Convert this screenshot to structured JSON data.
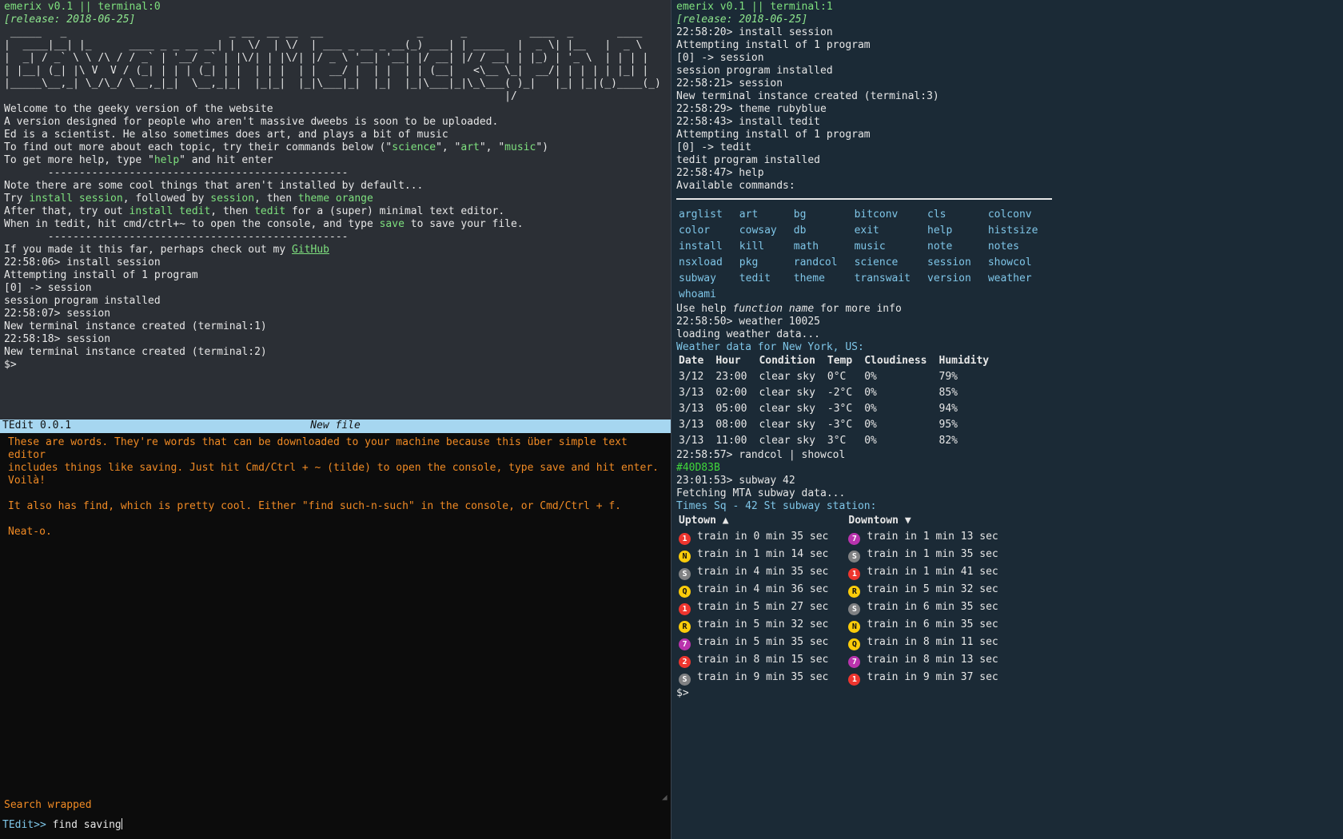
{
  "colors": {
    "t0_bg": "#2b2f35",
    "t1_bg": "#1b2a36",
    "green": "#7ee07e",
    "cyan": "#7fc6e8",
    "orange": "#f08a24",
    "tedit_bar": "#a6d6f0"
  },
  "t0": {
    "header": "emerix v0.1 || terminal:0",
    "release": "[release: 2018-06-25]",
    "ascii": [
      " _____   _                          _ __  __ __  __               _      _          ____  _       ____ ",
      "|  ____|__| |_      ____ _ _ __ __| |  \\/  | \\/  | ___ _ __ _ __(_) ___| | _____  |  _ \\| |__   |  _ \\",
      "|  _| / _` \\ \\ /\\ / / _` | '__/ _` | |\\/| | |\\/| |/ _ \\ '__| '__| |/ __| |/ / __| | |_) | '_ \\  | | | |",
      "| |__| (_| |\\ V  V / (_| | | | (_| | |  | | |  | |  __/ |  | |  | | (__|   <\\__ \\_|  __/| | | | | |_| |",
      "|_____\\__,_| \\_/\\_/ \\__,_|_|  \\__,_|_|  |_|_|  |_|\\___|_|  |_|  |_|\\___|_|\\_\\___( )_|   |_| |_|(_)____(_)",
      "                                                                                |/"
    ],
    "intro": [
      "Welcome to the geeky version of the website",
      "A version designed for people who aren't massive dweebs is soon to be uploaded.",
      "Ed is a scientist. He also sometimes does art, and plays a bit of music"
    ],
    "topics_prefix": "To find out more about each topic, try their commands below (\"",
    "topics": [
      "science",
      "art",
      "music"
    ],
    "help_prefix": "To get more help, type \"",
    "help_word": "help",
    "help_suffix": "\" and hit enter",
    "rule": "       ------------------------------------------------",
    "note": "Note there are some cool things that aren't installed by default...",
    "try_prefix": "Try ",
    "try_cmd1": "install session",
    "try_mid1": ", followed by ",
    "try_cmd2": "session",
    "try_mid2": ", then ",
    "try_cmd3": "theme orange",
    "after_prefix": "After that, try out ",
    "after_cmd1": "install tedit",
    "after_mid": ", then ",
    "after_cmd2": "tedit",
    "after_suffix": " for a (super) minimal text editor.",
    "when_prefix": "When in tedit, hit cmd/ctrl+~ to open the console, and type ",
    "when_cmd": "save",
    "when_suffix": " to save your file.",
    "github_prefix": "If you made it this far, perhaps check out my ",
    "github": "GitHub",
    "log": [
      "22:58:06> install session",
      "Attempting install of 1 program",
      "[0] -> session",
      "session program installed",
      "22:58:07> session",
      "New terminal instance created (terminal:1)",
      "22:58:18> session",
      "New terminal instance created (terminal:2)",
      "$>"
    ]
  },
  "tedit": {
    "title": "TEdit 0.0.1",
    "file": "New file",
    "text": "These are words. They're words that can be downloaded to your machine because this über simple text editor\nincludes things like saving. Just hit Cmd/Ctrl + ~ (tilde) to open the console, type save and hit enter.\nVoilà!\n\nIt also has find, which is pretty cool. Either \"find such-n-such\" in the console, or Cmd/Ctrl + f.\n\nNeat-o.",
    "status": "Search wrapped",
    "prompt": "TEdit>>",
    "command": "find saving"
  },
  "t1": {
    "header": "emerix v0.1 || terminal:1",
    "release": "[release: 2018-06-25]",
    "log1": [
      "22:58:20> install session",
      "Attempting install of 1 program",
      "[0] -> session",
      "session program installed",
      "22:58:21> session",
      "New terminal instance created (terminal:3)",
      "22:58:29> theme rubyblue",
      "22:58:43> install tedit",
      "Attempting install of 1 program",
      "[0] -> tedit",
      "tedit program installed",
      "22:58:47> help",
      "Available commands:"
    ],
    "commands": [
      [
        "arglist",
        "art",
        "bg",
        "bitconv",
        "cls",
        "colconv"
      ],
      [
        "color",
        "cowsay",
        "db",
        "exit",
        "help",
        "histsize"
      ],
      [
        "install",
        "kill",
        "math",
        "music",
        "note",
        "notes"
      ],
      [
        "nsxload",
        "pkg",
        "randcol",
        "science",
        "session",
        "showcol"
      ],
      [
        "subway",
        "tedit",
        "theme",
        "transwait",
        "version",
        "weather"
      ],
      [
        "whoami"
      ]
    ],
    "help_hint_prefix": "Use help ",
    "help_hint_em": "function name",
    "help_hint_suffix": " for more info",
    "weather_cmd": "22:58:50> weather 10025",
    "weather_loading": "loading weather data...",
    "weather_title": "Weather data for New York, US:",
    "weather_headers": [
      "Date",
      "Hour",
      "Condition",
      "Temp",
      "Cloudiness",
      "Humidity"
    ],
    "weather_rows": [
      [
        "3/12",
        "23:00",
        "clear sky",
        "0°C",
        "0%",
        "79%"
      ],
      [
        "3/13",
        "02:00",
        "clear sky",
        "-2°C",
        "0%",
        "85%"
      ],
      [
        "3/13",
        "05:00",
        "clear sky",
        "-3°C",
        "0%",
        "94%"
      ],
      [
        "3/13",
        "08:00",
        "clear sky",
        "-3°C",
        "0%",
        "95%"
      ],
      [
        "3/13",
        "11:00",
        "clear sky",
        "3°C",
        "0%",
        "82%"
      ]
    ],
    "randcol_cmd": "22:58:57> randcol | showcol",
    "randcol_value": "#40D83B",
    "subway_cmd": "23:01:53> subway 42",
    "subway_loading": "Fetching MTA subway data...",
    "subway_title": "Times Sq - 42 St subway station:",
    "uptown": "Uptown ▲",
    "downtown": "Downtown ▼",
    "subway_rows": [
      {
        "up_line": "1",
        "up_text": "train in 0 min 35 sec",
        "down_line": "7",
        "down_text": "train in 1 min 13 sec"
      },
      {
        "up_line": "N",
        "up_text": "train in 1 min 14 sec",
        "down_line": "S",
        "down_text": "train in 1 min 35 sec"
      },
      {
        "up_line": "S",
        "up_text": "train in 4 min 35 sec",
        "down_line": "1",
        "down_text": "train in 1 min 41 sec"
      },
      {
        "up_line": "Q",
        "up_text": "train in 4 min 36 sec",
        "down_line": "R",
        "down_text": "train in 5 min 32 sec"
      },
      {
        "up_line": "1",
        "up_text": "train in 5 min 27 sec",
        "down_line": "S",
        "down_text": "train in 6 min 35 sec"
      },
      {
        "up_line": "R",
        "up_text": "train in 5 min 32 sec",
        "down_line": "N",
        "down_text": "train in 6 min 35 sec"
      },
      {
        "up_line": "7",
        "up_text": "train in 5 min 35 sec",
        "down_line": "Q",
        "down_text": "train in 8 min 11 sec"
      },
      {
        "up_line": "2",
        "up_text": "train in 8 min 15 sec",
        "down_line": "7",
        "down_text": "train in 8 min 13 sec"
      },
      {
        "up_line": "S",
        "up_text": "train in 9 min 35 sec",
        "down_line": "1",
        "down_text": "train in 9 min 37 sec"
      }
    ],
    "line_colors": {
      "1": "#ee352e",
      "2": "#ee352e",
      "7": "#b933ad",
      "S": "#808183",
      "N": "#fccc0a",
      "Q": "#fccc0a",
      "R": "#fccc0a"
    },
    "prompt": "$>"
  }
}
